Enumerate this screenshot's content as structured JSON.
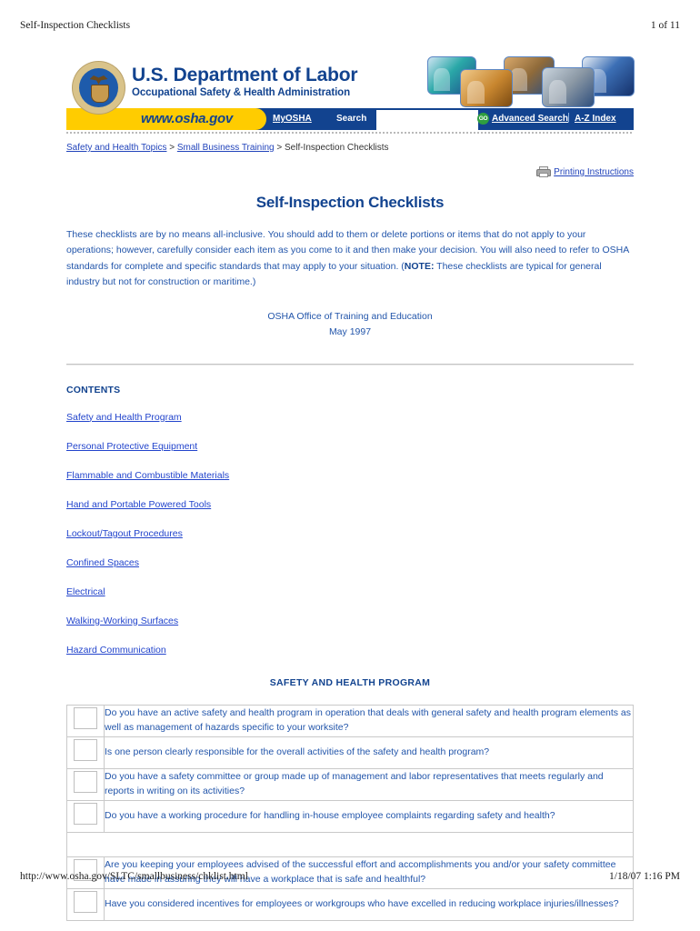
{
  "print_header": {
    "left": "Self-Inspection Checklists",
    "right": "1 of 11"
  },
  "print_footer": {
    "url": "http://www.osha.gov/SLTC/smallbusiness/chklist.html",
    "timestamp": "1/18/07 1:16 PM"
  },
  "banner": {
    "agency_line1": "U.S. Department of Labor",
    "agency_line2": "Occupational Safety & Health Administration",
    "site_url": "www.osha.gov",
    "myosha": "MyOSHA",
    "search_label": "Search",
    "search_value": "",
    "search_placeholder": "",
    "go_label": "GO",
    "advanced_search": "Advanced Search",
    "separator": "|",
    "az_index": "A-Z Index",
    "colors": {
      "brand_blue": "#12438f",
      "brand_yellow": "#ffcc00",
      "go_green": "#2f9e3f",
      "link_blue": "#2244cc",
      "body_blue": "#2255aa"
    }
  },
  "breadcrumb": {
    "items": [
      {
        "label": "Safety and Health Topics",
        "is_link": true
      },
      {
        "label": "Small Business Training",
        "is_link": true
      },
      {
        "label": "Self-Inspection Checklists",
        "is_link": false
      }
    ],
    "separator": ">"
  },
  "printing": {
    "label": "Printing Instructions"
  },
  "main": {
    "title": "Self-Inspection Checklists",
    "intro_part1": "These checklists are by no means all-inclusive. You should add to them or delete portions or items that do not apply to your operations; however, carefully consider each item as you come to it and then make your decision. You will also need to refer to OSHA standards for complete and specific standards that may apply to your situation. (",
    "intro_note_label": "NOTE:",
    "intro_part2": " These checklists are typical for general industry but not for construction or maritime.)",
    "credit_line1": "OSHA Office of Training and Education",
    "credit_line2": "May 1997"
  },
  "contents": {
    "heading": "CONTENTS",
    "items": [
      {
        "label": "Safety and Health Program"
      },
      {
        "label": "Personal Protective Equipment"
      },
      {
        "label": "Flammable and Combustible Materials"
      },
      {
        "label": "Hand and Portable Powered Tools"
      },
      {
        "label": "Lockout/Tagout Procedures"
      },
      {
        "label": "Confined Spaces"
      },
      {
        "label": "Electrical"
      },
      {
        "label": "Walking-Working Surfaces"
      },
      {
        "label": "Hazard Communication"
      }
    ]
  },
  "section": {
    "heading": "SAFETY AND HEALTH PROGRAM",
    "rows": [
      {
        "has_checkbox": true,
        "question": "Do you have an active safety and health program in operation that deals with general safety and health program elements as well as management of hazards specific to your worksite?"
      },
      {
        "has_checkbox": true,
        "question": "Is one person clearly responsible for the overall activities of the safety and health program?"
      },
      {
        "has_checkbox": true,
        "question": "Do you have a safety committee or group made up of management and labor representatives that meets regularly and reports in writing on its activities?"
      },
      {
        "has_checkbox": true,
        "question": "Do you have a working procedure for handling in-house employee complaints regarding safety and health?"
      },
      {
        "has_checkbox": false,
        "question": ""
      },
      {
        "has_checkbox": true,
        "question": "Are you keeping your employees advised of the successful effort and accomplishments you and/or your safety committee have made in assuring they will have a workplace that is safe and healthful?"
      },
      {
        "has_checkbox": true,
        "question": "Have you considered incentives for employees or workgroups who have excelled in reducing workplace injuries/illnesses?"
      }
    ]
  }
}
